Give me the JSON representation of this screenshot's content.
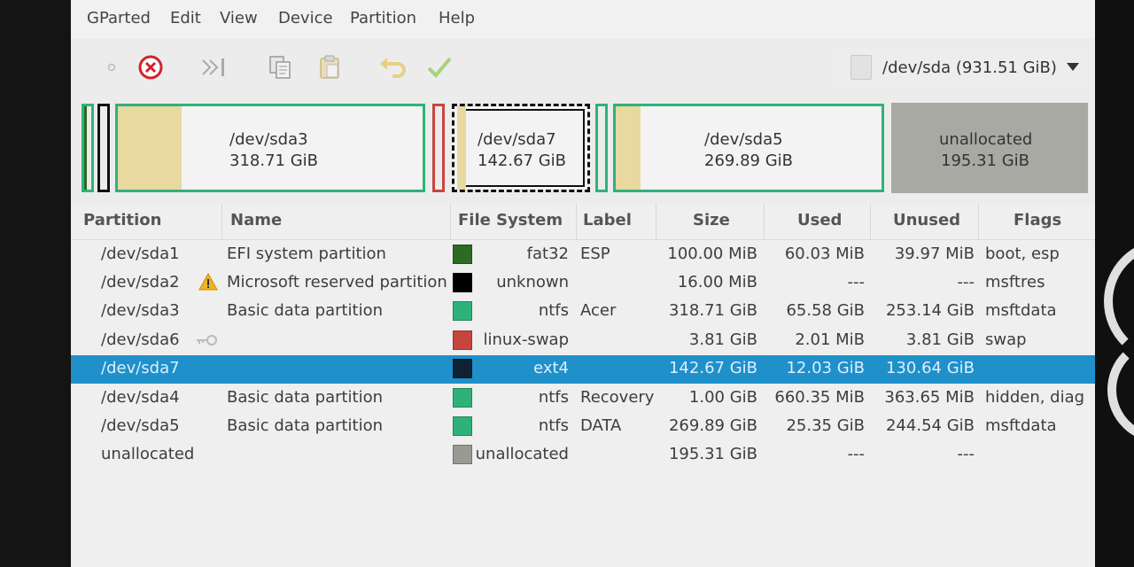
{
  "menubar": {
    "items": [
      "GParted",
      "Edit",
      "View",
      "Device",
      "Partition",
      "Help"
    ]
  },
  "toolbar": {
    "buttons": [
      "new-icon",
      "delete-icon",
      "resize-move-icon",
      "copy-icon",
      "paste-icon",
      "undo-icon",
      "apply-icon"
    ],
    "device": "/dev/sda  (931.51 GiB)"
  },
  "diskmap": {
    "segments": [
      {
        "name": "/dev/sda3",
        "size": "318.71 GiB"
      },
      {
        "name": "/dev/sda7",
        "size": "142.67 GiB"
      },
      {
        "name": "/dev/sda5",
        "size": "269.89 GiB"
      },
      {
        "name": "unallocated",
        "size": "195.31 GiB"
      }
    ]
  },
  "table": {
    "headers": [
      "Partition",
      "Name",
      "File System",
      "Label",
      "Size",
      "Used",
      "Unused",
      "Flags"
    ],
    "rows": [
      {
        "partition": "/dev/sda1",
        "name": "EFI system partition",
        "fs": "fat32",
        "fs_color": "#2d6a22",
        "label": "ESP",
        "size": "100.00 MiB",
        "used": "60.03 MiB",
        "unused": "39.97 MiB",
        "flags": "boot, esp"
      },
      {
        "partition": "/dev/sda2",
        "name": "Microsoft reserved partition",
        "fs": "unknown",
        "fs_color": "#000000",
        "label": "",
        "size": "16.00 MiB",
        "used": "---",
        "unused": "---",
        "flags": "msftres"
      },
      {
        "partition": "/dev/sda3",
        "name": "Basic data partition",
        "fs": "ntfs",
        "fs_color": "#2fb27a",
        "label": "Acer",
        "size": "318.71 GiB",
        "used": "65.58 GiB",
        "unused": "253.14 GiB",
        "flags": "msftdata"
      },
      {
        "partition": "/dev/sda6",
        "name": "",
        "fs": "linux-swap",
        "fs_color": "#c8453d",
        "label": "",
        "size": "3.81 GiB",
        "used": "2.01 MiB",
        "unused": "3.81 GiB",
        "flags": "swap"
      },
      {
        "partition": "/dev/sda7",
        "name": "",
        "fs": "ext4",
        "fs_color": "#0f2233",
        "label": "",
        "size": "142.67 GiB",
        "used": "12.03 GiB",
        "unused": "130.64 GiB",
        "flags": ""
      },
      {
        "partition": "/dev/sda4",
        "name": "Basic data partition",
        "fs": "ntfs",
        "fs_color": "#2fb27a",
        "label": "Recovery",
        "size": "1.00 GiB",
        "used": "660.35 MiB",
        "unused": "363.65 MiB",
        "flags": "hidden, diag"
      },
      {
        "partition": "/dev/sda5",
        "name": "Basic data partition",
        "fs": "ntfs",
        "fs_color": "#2fb27a",
        "label": "DATA",
        "size": "269.89 GiB",
        "used": "25.35 GiB",
        "unused": "244.54 GiB",
        "flags": "msftdata"
      },
      {
        "partition": "unallocated",
        "name": "",
        "fs": "unallocated",
        "fs_color": "#9a9a94",
        "label": "",
        "size": "195.31 GiB",
        "used": "---",
        "unused": "---",
        "flags": ""
      }
    ]
  },
  "colors": {
    "ntfs": "#2fb27a",
    "selection": "#1f90c9",
    "unallocated": "#a9a9a4"
  }
}
